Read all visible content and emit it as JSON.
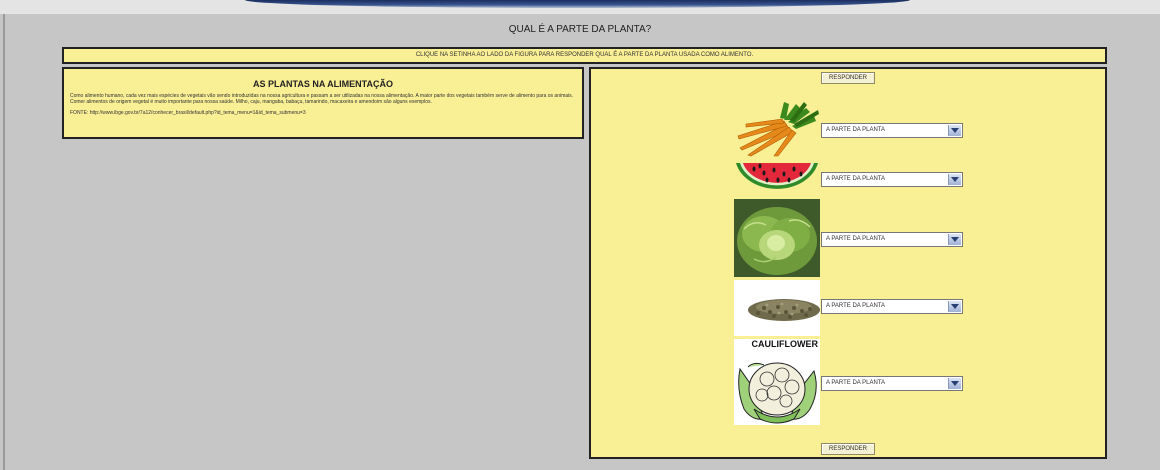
{
  "page": {
    "title": "QUAL É A PARTE DA PLANTA?",
    "instruction": "CLIQUE NA SETINHA AO LADO DA FIGURA PARA RESPONDER QUAL É A PARTE DA PLANTA USADA COMO ALIMENTO."
  },
  "info": {
    "heading": "AS PLANTAS NA ALIMENTAÇÃO",
    "paragraph1": "Como alimento humano, cada vez mais espécies de vegetais vão sendo introduzidas na nossa agricultura e passam a ser utilizadas na nossa alimentação. A maior parte dos vegetais também serve de alimento para os animais.",
    "paragraph2": "Comer alimentos de origem vegetal é muito importante para nossa saúde. Milho, caju, mangaba, babaçu, tamarindo, macaxeira e amendoim são alguns exemplos.",
    "source": "FONTE: http://www.ibge.gov.br/7a12/conhecer_brasil/default.php?id_tema_menu=1&id_tema_submenu=3"
  },
  "quiz": {
    "responder_label": "RESPONDER",
    "items": [
      {
        "image": "carrot-image",
        "select_value": "A PARTE DA PLANTA"
      },
      {
        "image": "watermelon-image",
        "select_value": "A PARTE DA PLANTA"
      },
      {
        "image": "lettuce-image",
        "select_value": "A PARTE DA PLANTA"
      },
      {
        "image": "seeds-image",
        "select_value": "A PARTE DA PLANTA"
      },
      {
        "image": "cauliflower-image",
        "select_value": "A PARTE DA PLANTA",
        "caption": "CAULIFLOWER"
      }
    ]
  },
  "colors": {
    "panel_bg": "#f9ef95",
    "page_bg": "#c6c6c6",
    "border": "#222222"
  }
}
